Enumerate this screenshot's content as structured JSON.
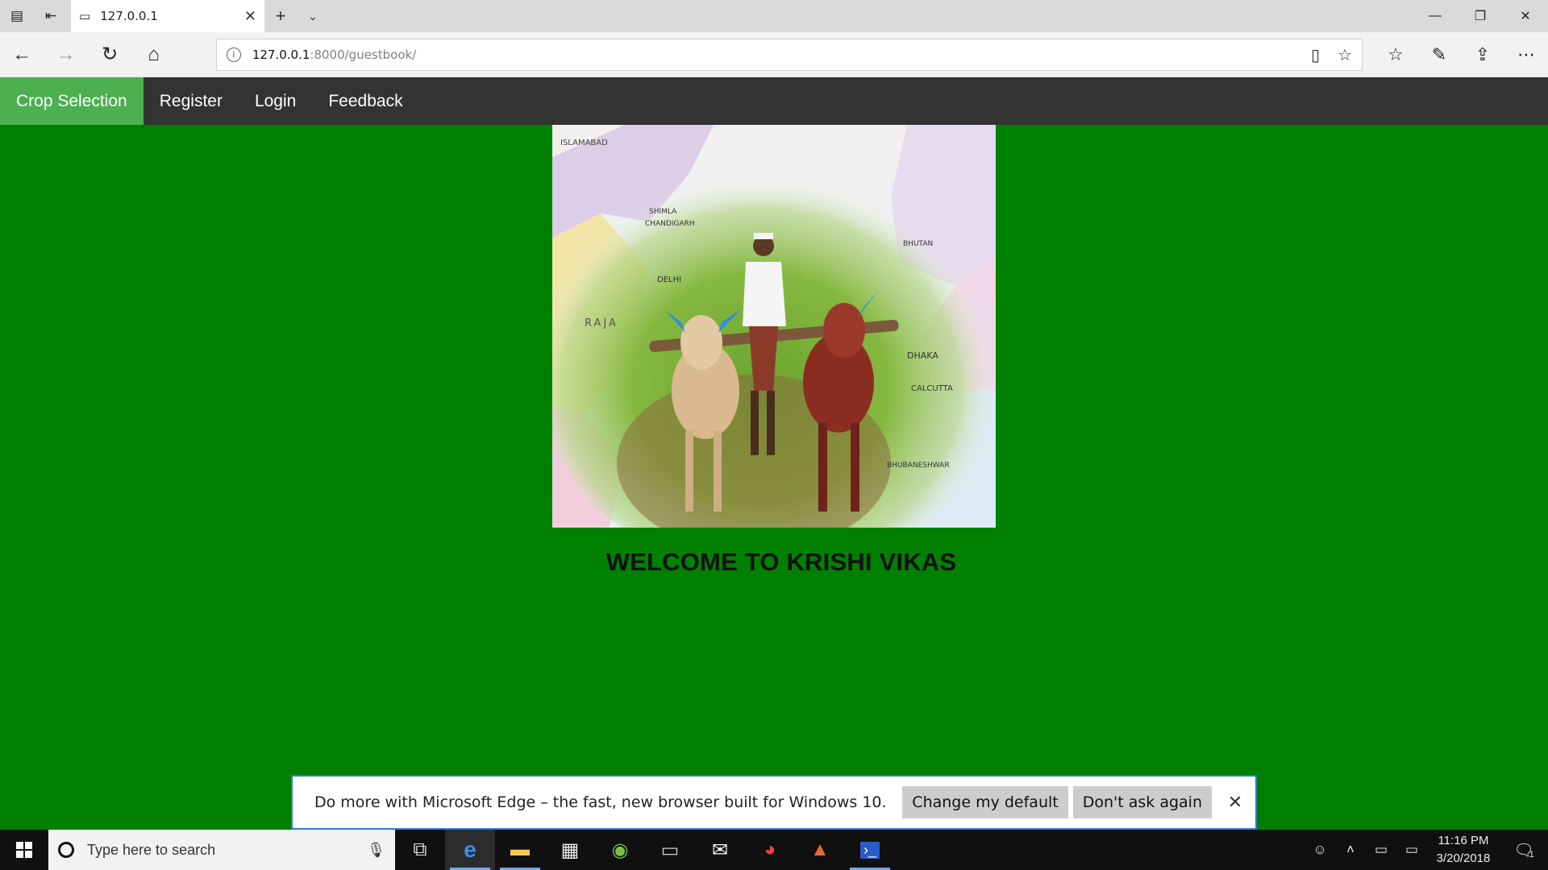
{
  "browser": {
    "tab_title": "127.0.0.1",
    "url_host": "127.0.0.1",
    "url_path": ":8000/guestbook/"
  },
  "site_nav": {
    "items": [
      {
        "label": "Crop Selection",
        "active": true
      },
      {
        "label": "Register"
      },
      {
        "label": "Login"
      },
      {
        "label": "Feedback"
      }
    ]
  },
  "page": {
    "welcome": "WELCOME TO KRISHI VIKAS"
  },
  "map_labels": {
    "islamabad": "ISLAMABAD",
    "shimla": "SHIMLA",
    "chandigarh": "CHANDIGARH",
    "delhi": "DELHI",
    "raja": "RAJA",
    "bhutan": "BHUTAN",
    "dhaka": "DHAKA",
    "calcutta": "CALCUTTA",
    "bhubaneshwar": "BHUBANESHWAR"
  },
  "notification": {
    "text": "Do more with Microsoft Edge – the fast, new browser built for Windows 10.",
    "change_default": "Change my default",
    "dont_ask": "Don't ask again"
  },
  "taskbar": {
    "search_placeholder": "Type here to search",
    "time": "11:16 PM",
    "date": "3/20/2018",
    "notifications_count": "1"
  },
  "colors": {
    "page_bg": "#008000",
    "nav_bg": "#333333",
    "nav_active": "#4CAF50"
  }
}
